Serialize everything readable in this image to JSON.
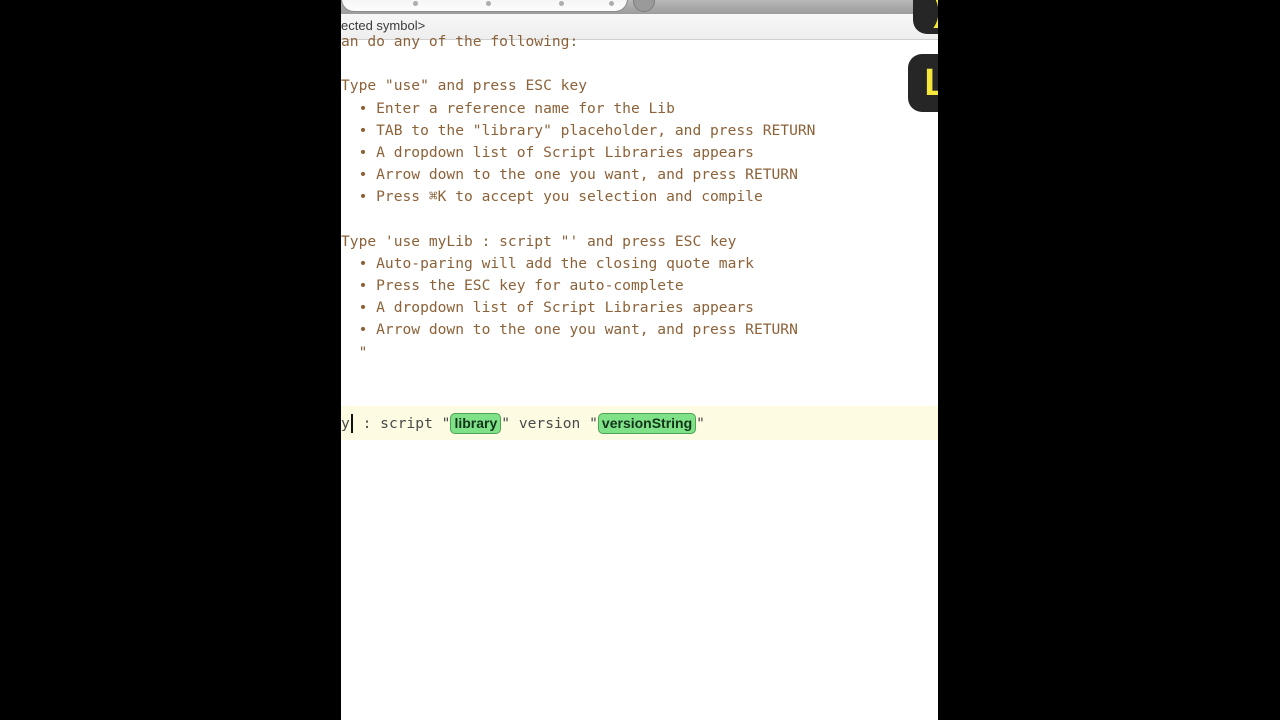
{
  "window": {
    "symbol_bar_label": "ected symbol>"
  },
  "toolbar": {
    "search_placeholder": ""
  },
  "editor": {
    "lines": [
      "an do any of the following:",
      "",
      "Type \"use\" and press ESC key",
      "  • Enter a reference name for the Lib",
      "  • TAB to the \"library\" placeholder, and press RETURN",
      "  • A dropdown list of Script Libraries appears",
      "  • Arrow down to the one you want, and press RETURN",
      "  • Press ⌘K to accept you selection and compile",
      "",
      "Type 'use myLib : script \"' and press ESC key",
      "  • Auto-paring will add the closing quote mark",
      "  • Press the ESC key for auto-complete",
      "  • A dropdown list of Script Libraries appears",
      "  • Arrow down to the one you want, and press RETURN",
      "  \""
    ]
  },
  "template_bar": {
    "prefix": "y",
    "segment_1": " : script \"",
    "token_1": "library",
    "segment_2": "\" version \"",
    "token_2": "versionString",
    "segment_3": "\"",
    "token_color": "#7fe288",
    "bar_color": "#fdfbe2"
  },
  "key_badges": [
    {
      "glyph": ")"
    },
    {
      "glyph": "L"
    }
  ]
}
